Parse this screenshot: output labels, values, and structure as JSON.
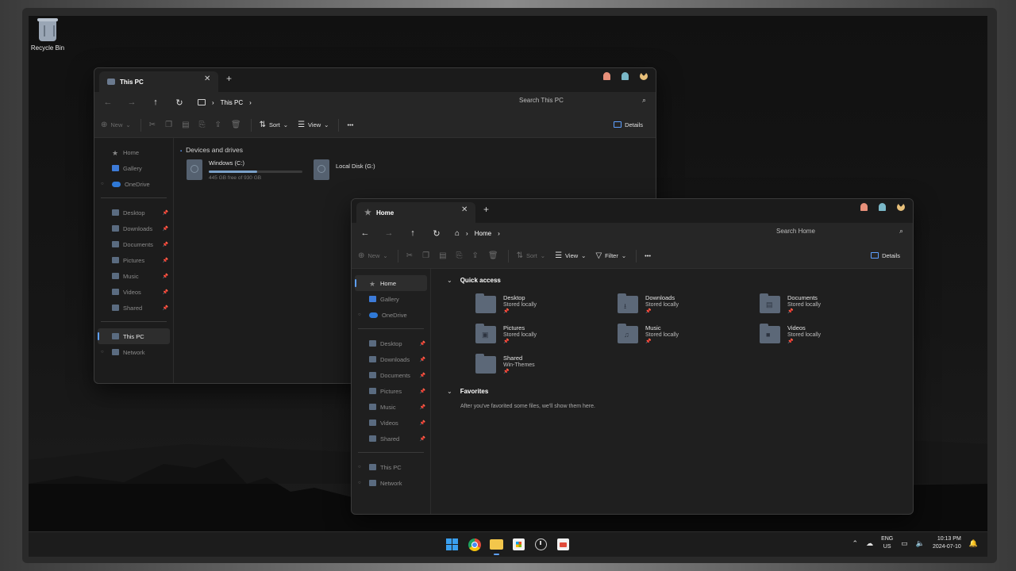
{
  "desktop": {
    "recycle_bin_label": "Recycle Bin"
  },
  "win_back": {
    "tab_title": "This PC",
    "tab_close": "✕",
    "tab_add": "+",
    "breadcrumb": [
      "This PC"
    ],
    "search_placeholder": "Search This PC",
    "toolbar": {
      "new": "New",
      "sort": "Sort",
      "view": "View",
      "more": "•••",
      "details": "Details"
    },
    "nav_top": [
      {
        "label": "Home",
        "icon": "star-icon"
      },
      {
        "label": "Gallery",
        "icon": "gallery-icon"
      },
      {
        "label": "OneDrive",
        "icon": "cloud-icon"
      }
    ],
    "nav_pinned": [
      {
        "label": "Desktop"
      },
      {
        "label": "Downloads"
      },
      {
        "label": "Documents"
      },
      {
        "label": "Pictures"
      },
      {
        "label": "Music"
      },
      {
        "label": "Videos"
      },
      {
        "label": "Shared"
      }
    ],
    "nav_bottom": [
      {
        "label": "This PC"
      },
      {
        "label": "Network"
      }
    ],
    "section_title": "Devices and drives",
    "drives": [
      {
        "name": "Windows (C:)",
        "free": "445 GB free of 930 GB",
        "used_fraction": 0.52
      },
      {
        "name": "Local Disk (G:)"
      }
    ]
  },
  "win_front": {
    "tab_title": "Home",
    "tab_close": "✕",
    "tab_add": "+",
    "breadcrumb": [
      "Home"
    ],
    "search_placeholder": "Search Home",
    "toolbar": {
      "new": "New",
      "sort": "Sort",
      "view": "View",
      "filter": "Filter",
      "more": "•••",
      "details": "Details"
    },
    "nav_top": [
      {
        "label": "Home",
        "icon": "star-icon"
      },
      {
        "label": "Gallery",
        "icon": "gallery-icon"
      },
      {
        "label": "OneDrive",
        "icon": "cloud-icon"
      }
    ],
    "nav_pinned": [
      {
        "label": "Desktop"
      },
      {
        "label": "Downloads"
      },
      {
        "label": "Documents"
      },
      {
        "label": "Pictures"
      },
      {
        "label": "Music"
      },
      {
        "label": "Videos"
      },
      {
        "label": "Shared"
      }
    ],
    "nav_bottom": [
      {
        "label": "This PC"
      },
      {
        "label": "Network"
      }
    ],
    "quick_access_title": "Quick access",
    "quick_access": [
      {
        "name": "Desktop",
        "sub": "Stored locally",
        "glyph": ""
      },
      {
        "name": "Downloads",
        "sub": "Stored locally",
        "glyph": "⭳"
      },
      {
        "name": "Documents",
        "sub": "Stored locally",
        "glyph": "▤"
      },
      {
        "name": "Pictures",
        "sub": "Stored locally",
        "glyph": "▣"
      },
      {
        "name": "Music",
        "sub": "Stored locally",
        "glyph": "♫"
      },
      {
        "name": "Videos",
        "sub": "Stored locally",
        "glyph": "■"
      },
      {
        "name": "Shared",
        "sub": "Win-Themes",
        "glyph": ""
      }
    ],
    "favorites_title": "Favorites",
    "favorites_empty": "After you've favorited some files, we'll show them here."
  },
  "taskbar": {
    "apps": [
      "start-icon",
      "chrome-icon",
      "file-explorer-icon",
      "store-icon",
      "clock-icon",
      "snipping-tool-icon"
    ],
    "lang_1": "ENG",
    "lang_2": "US",
    "time": "10:13 PM",
    "date": "2024-07-10"
  },
  "colors": {
    "accent": "#5ea0ff",
    "window_bg": "#1f1f1f",
    "folder": "#5c6878"
  }
}
